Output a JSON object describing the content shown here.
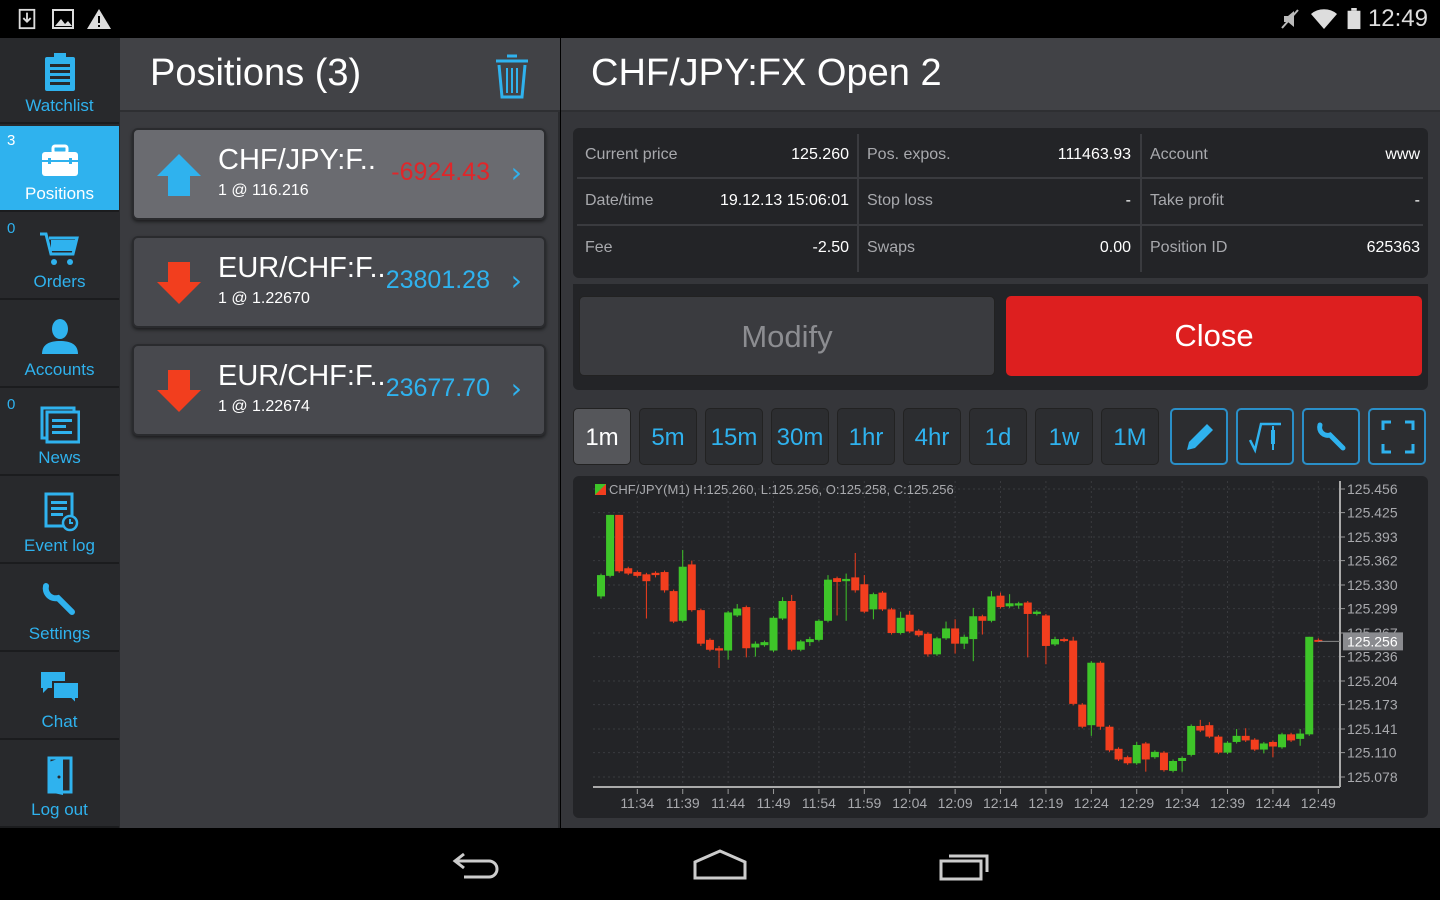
{
  "status_bar": {
    "time": "12:49",
    "icons": [
      "download-icon",
      "image-icon",
      "warning-icon",
      "mute-icon",
      "wifi-icon",
      "battery-icon"
    ]
  },
  "sidebar": {
    "items": [
      {
        "label": "Watchlist",
        "icon": "clipboard-list-icon",
        "badge": ""
      },
      {
        "label": "Positions",
        "icon": "briefcase-icon",
        "badge": "3",
        "active": true
      },
      {
        "label": "Orders",
        "icon": "cart-icon",
        "badge": "0"
      },
      {
        "label": "Accounts",
        "icon": "user-icon",
        "badge": ""
      },
      {
        "label": "News",
        "icon": "newspaper-icon",
        "badge": "0"
      },
      {
        "label": "Event log",
        "icon": "event-log-icon",
        "badge": ""
      },
      {
        "label": "Settings",
        "icon": "wrench-icon",
        "badge": ""
      },
      {
        "label": "Chat",
        "icon": "chat-icon",
        "badge": ""
      },
      {
        "label": "Log out",
        "icon": "door-icon",
        "badge": ""
      }
    ]
  },
  "positions": {
    "title": "Positions (3)",
    "items": [
      {
        "symbol": "CHF/JPY:F..",
        "detail": "1 @ 116.216",
        "pl": "-6924.43",
        "direction": "up",
        "pl_color": "#e0262a",
        "selected": true
      },
      {
        "symbol": "EUR/CHF:F..",
        "detail": "1 @ 1.22670",
        "pl": "23801.28",
        "direction": "down",
        "pl_color": "#2fb2ee"
      },
      {
        "symbol": "EUR/CHF:F..",
        "detail": "1 @ 1.22674",
        "pl": "23677.70",
        "direction": "down",
        "pl_color": "#2fb2ee"
      }
    ]
  },
  "detail": {
    "title": "CHF/JPY:FX Open 2",
    "fields": [
      {
        "label": "Current price",
        "value": "125.260"
      },
      {
        "label": "Pos. expos.",
        "value": "111463.93"
      },
      {
        "label": "Account",
        "value": "www"
      },
      {
        "label": "Date/time",
        "value": "19.12.13 15:06:01"
      },
      {
        "label": "Stop loss",
        "value": "-"
      },
      {
        "label": "Take profit",
        "value": "-"
      },
      {
        "label": "Fee",
        "value": "-2.50"
      },
      {
        "label": "Swaps",
        "value": "0.00"
      },
      {
        "label": "Position ID",
        "value": "625363"
      }
    ],
    "modify_label": "Modify",
    "close_label": "Close",
    "timeframes": [
      "1m",
      "5m",
      "15m",
      "30m",
      "1hr",
      "4hr",
      "1d",
      "1w",
      "1M"
    ],
    "active_timeframe": "1m",
    "tools": [
      "pencil-icon",
      "indicator-icon",
      "wrench-icon",
      "fullscreen-icon"
    ]
  },
  "colors": {
    "accent": "#2fb2ee",
    "close": "#dd1f1f",
    "bull": "#3ec529",
    "bear": "#f23e1e"
  },
  "chart_data": {
    "type": "candlestick",
    "title": "CHF/JPY(M1) H:125.260, L:125.256, O:125.258, C:125.256",
    "last_price_label": "125.256",
    "ylim": [
      125.078,
      125.456
    ],
    "y_ticks": [
      "125.456",
      "125.425",
      "125.393",
      "125.362",
      "125.330",
      "125.299",
      "125.267",
      "125.236",
      "125.204",
      "125.173",
      "125.141",
      "125.110",
      "125.078"
    ],
    "x_ticks": [
      "11:34",
      "11:39",
      "11:44",
      "11:49",
      "11:54",
      "11:59",
      "12:04",
      "12:09",
      "12:14",
      "12:19",
      "12:24",
      "12:29",
      "12:34",
      "12:39",
      "12:44",
      "12:49"
    ],
    "grid": true,
    "candles_ohlc": [
      [
        "11:30",
        125.315,
        125.345,
        125.312,
        125.343
      ],
      [
        "11:31",
        125.342,
        125.422,
        125.34,
        125.422
      ],
      [
        "11:32",
        125.422,
        125.422,
        125.346,
        125.348
      ],
      [
        "11:33",
        125.352,
        125.354,
        125.343,
        125.345
      ],
      [
        "11:34",
        125.347,
        125.349,
        125.34,
        125.342
      ],
      [
        "11:35",
        125.344,
        125.346,
        125.286,
        125.335
      ],
      [
        "11:36",
        125.346,
        125.348,
        125.34,
        125.343
      ],
      [
        "11:37",
        125.347,
        125.349,
        125.32,
        125.323
      ],
      [
        "11:38",
        125.322,
        125.324,
        125.28,
        125.282
      ],
      [
        "11:39",
        125.283,
        125.376,
        125.281,
        125.354
      ],
      [
        "11:40",
        125.357,
        125.362,
        125.295,
        125.297
      ],
      [
        "11:41",
        125.297,
        125.299,
        125.25,
        125.253
      ],
      [
        "11:42",
        125.258,
        125.26,
        125.243,
        125.245
      ],
      [
        "11:43",
        125.247,
        125.25,
        125.221,
        125.244
      ],
      [
        "11:44",
        125.244,
        125.296,
        125.232,
        125.294
      ],
      [
        "11:45",
        125.29,
        125.305,
        125.288,
        125.299
      ],
      [
        "11:46",
        125.301,
        125.303,
        125.235,
        125.247
      ],
      [
        "11:47",
        125.248,
        125.256,
        125.236,
        125.253
      ],
      [
        "11:48",
        125.251,
        125.257,
        125.249,
        125.255
      ],
      [
        "11:49",
        125.244,
        125.289,
        125.242,
        125.287
      ],
      [
        "11:50",
        125.286,
        125.314,
        125.284,
        125.309
      ],
      [
        "11:51",
        125.309,
        125.317,
        125.243,
        125.245
      ],
      [
        "11:52",
        125.245,
        125.258,
        125.243,
        125.256
      ],
      [
        "11:53",
        125.255,
        125.262,
        125.25,
        125.259
      ],
      [
        "11:54",
        125.258,
        125.285,
        125.256,
        125.283
      ],
      [
        "11:55",
        125.283,
        125.343,
        125.281,
        125.337
      ],
      [
        "11:56",
        125.339,
        125.341,
        125.29,
        125.334
      ],
      [
        "11:57",
        125.335,
        125.345,
        125.283,
        125.338
      ],
      [
        "11:58",
        125.34,
        125.372,
        125.32,
        125.323
      ],
      [
        "11:59",
        125.331,
        125.343,
        125.293,
        125.295
      ],
      [
        "12:00",
        125.298,
        125.32,
        125.285,
        125.318
      ],
      [
        "12:01",
        125.32,
        125.322,
        125.296,
        125.298
      ],
      [
        "12:02",
        125.298,
        125.3,
        125.265,
        125.267
      ],
      [
        "12:03",
        125.267,
        125.295,
        125.265,
        125.287
      ],
      [
        "12:04",
        125.291,
        125.296,
        125.267,
        125.269
      ],
      [
        "12:05",
        125.27,
        125.272,
        125.262,
        125.264
      ],
      [
        "12:06",
        125.266,
        125.268,
        125.236,
        125.239
      ],
      [
        "12:07",
        125.239,
        125.262,
        125.237,
        125.26
      ],
      [
        "12:08",
        125.26,
        125.282,
        125.258,
        125.273
      ],
      [
        "12:09",
        125.273,
        125.285,
        125.24,
        125.253
      ],
      [
        "12:10",
        125.253,
        125.265,
        125.246,
        125.262
      ],
      [
        "12:11",
        125.259,
        125.3,
        125.23,
        125.289
      ],
      [
        "12:12",
        125.289,
        125.291,
        125.265,
        125.283
      ],
      [
        "12:13",
        125.283,
        125.322,
        125.281,
        125.315
      ],
      [
        "12:14",
        125.316,
        125.32,
        125.299,
        125.301
      ],
      [
        "12:15",
        125.302,
        125.318,
        125.3,
        125.306
      ],
      [
        "12:16",
        125.303,
        125.308,
        125.299,
        125.306
      ],
      [
        "12:17",
        125.307,
        125.309,
        125.235,
        125.292
      ],
      [
        "12:18",
        125.292,
        125.297,
        125.29,
        125.295
      ],
      [
        "12:19",
        125.29,
        125.292,
        125.226,
        125.25
      ],
      [
        "12:20",
        125.252,
        125.262,
        125.25,
        125.259
      ],
      [
        "12:21",
        125.259,
        125.261,
        125.255,
        125.257
      ],
      [
        "12:22",
        125.257,
        125.262,
        125.172,
        125.174
      ],
      [
        "12:23",
        125.173,
        125.175,
        125.142,
        125.144
      ],
      [
        "12:24",
        125.146,
        125.23,
        125.132,
        125.228
      ],
      [
        "12:25",
        125.228,
        125.23,
        125.14,
        125.144
      ],
      [
        "12:26",
        125.144,
        125.146,
        125.111,
        125.113
      ],
      [
        "12:27",
        125.115,
        125.117,
        125.099,
        125.101
      ],
      [
        "12:28",
        125.104,
        125.106,
        125.094,
        125.096
      ],
      [
        "12:29",
        125.096,
        125.124,
        125.094,
        125.12
      ],
      [
        "12:30",
        125.122,
        125.124,
        125.085,
        125.101
      ],
      [
        "12:31",
        125.104,
        125.113,
        125.102,
        125.111
      ],
      [
        "12:32",
        125.11,
        125.112,
        125.085,
        125.087
      ],
      [
        "12:33",
        125.086,
        125.101,
        125.084,
        125.099
      ],
      [
        "12:34",
        125.099,
        125.105,
        125.085,
        125.103
      ],
      [
        "12:35",
        125.107,
        125.147,
        125.105,
        125.145
      ],
      [
        "12:36",
        125.145,
        125.153,
        125.137,
        125.139
      ],
      [
        "12:37",
        125.146,
        125.15,
        125.129,
        125.131
      ],
      [
        "12:38",
        125.131,
        125.133,
        125.108,
        125.11
      ],
      [
        "12:39",
        125.11,
        125.125,
        125.108,
        125.123
      ],
      [
        "12:40",
        125.124,
        125.141,
        125.122,
        125.132
      ],
      [
        "12:41",
        125.132,
        125.142,
        125.124,
        125.126
      ],
      [
        "12:42",
        125.127,
        125.129,
        125.112,
        125.114
      ],
      [
        "12:43",
        125.114,
        125.124,
        125.109,
        125.122
      ],
      [
        "12:44",
        125.124,
        125.126,
        125.104,
        125.118
      ],
      [
        "12:45",
        125.117,
        125.136,
        125.115,
        125.134
      ],
      [
        "12:46",
        125.134,
        125.136,
        125.124,
        125.126
      ],
      [
        "12:47",
        125.128,
        125.141,
        125.119,
        125.135
      ],
      [
        "12:48",
        125.134,
        125.262,
        125.132,
        125.262
      ],
      [
        "12:49",
        125.258,
        125.26,
        125.256,
        125.256
      ]
    ]
  },
  "nav_bar": {
    "buttons": [
      "back-icon",
      "home-icon",
      "recents-icon"
    ]
  }
}
